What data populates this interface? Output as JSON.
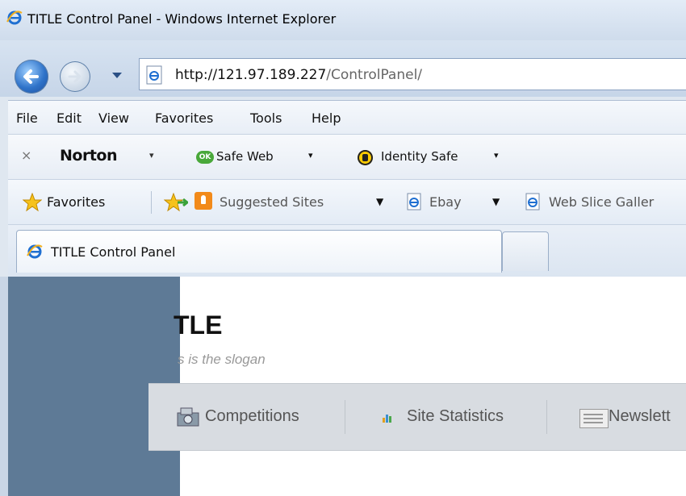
{
  "window": {
    "title": "TITLE Control Panel - Windows Internet Explorer",
    "address_host": "http://121.97.189.227",
    "address_path": "/ControlPanel/"
  },
  "menu": {
    "items": [
      "File",
      "Edit",
      "View",
      "Favorites",
      "Tools",
      "Help"
    ]
  },
  "norton_bar": {
    "close_glyph": "×",
    "brand": "Norton",
    "safe_web_badge": "OK",
    "safe_web": "Safe Web",
    "identity_safe": "Identity Safe",
    "dropdown_glyph": "▾"
  },
  "favorites_bar": {
    "favorites": "Favorites",
    "suggested_sites": "Suggested Sites",
    "ebay": "Ebay",
    "web_slice_gallery": "Web Slice Galler",
    "dropdown_glyph": "▼"
  },
  "tab": {
    "title": "TITLE Control Panel"
  },
  "page": {
    "site_title": "TLE",
    "slogan": "s is the slogan",
    "nav": [
      "Competitions",
      "Site Statistics",
      "Newslett"
    ]
  },
  "colors": {
    "sidebar": "#5e7a96",
    "nav_strip": "#d8dce1",
    "ie_blue": "#1f6fd1",
    "norton_ok": "#49a83a"
  },
  "icons": [
    "ie-logo-icon",
    "back-arrow-icon",
    "forward-arrow-icon",
    "page-icon",
    "favorites-star-icon",
    "add-favorite-icon",
    "suggested-sites-icon",
    "ok-badge-icon",
    "lock-icon",
    "competitions-icon",
    "statistics-icon",
    "newsletter-icon"
  ]
}
